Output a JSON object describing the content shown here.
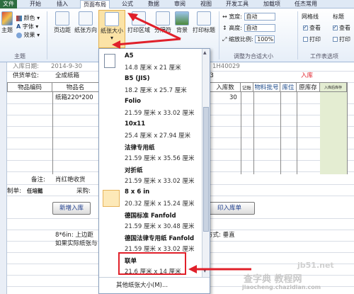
{
  "ribbon": {
    "tabs": [
      "文件",
      "开始",
      "插入",
      "页面布局",
      "公式",
      "数据",
      "审阅",
      "视图",
      "开发工具",
      "加载项",
      "任杰常用"
    ],
    "theme_group": {
      "themes_label": "主题",
      "colors_label": "颜色",
      "fonts_label": "字体",
      "effects_label": "效果",
      "group_label": "主题"
    },
    "page_setup": {
      "margins_label": "页边距",
      "orientation_label": "纸张方向",
      "size_label": "纸张大小",
      "print_area_label": "打印区域",
      "breaks_label": "分隔符",
      "background_label": "背景",
      "print_titles_label": "打印标题"
    },
    "scale_to_fit": {
      "width_label": "宽度:",
      "width_value": "自动",
      "height_label": "高度:",
      "height_value": "自动",
      "scale_label": "缩放比例:",
      "scale_value": "100%",
      "group_label": "调整为合适大小"
    },
    "sheet_options": {
      "gridlines_label": "网格线",
      "headings_label": "标题",
      "view_label": "查看",
      "print_label": "打印",
      "group_label": "工作表选项"
    }
  },
  "sheet": {
    "row1_left": "入库日期:",
    "row1_date": "2014-9-30",
    "row1_right": "1H40029",
    "supplier_label": "供货单位:",
    "supplier_value": "全成纸箱",
    "supplier_code": "03",
    "in_stock_red": "入库",
    "headers": [
      "物品编码",
      "物品名",
      "入库数",
      "记账",
      "物料批号",
      "库位",
      "原库存",
      "入库后库存"
    ],
    "item_name": "纸箱220*200",
    "quantity": "30",
    "remark_label": "备注:",
    "remark_value": "肖红艳收货",
    "maker_label": "制单:",
    "maker_value": "任培懿",
    "buyer_label": "采购:",
    "add_button": "新增入库",
    "print_button": "印入库单",
    "note_line1": "8*6in: 上边距",
    "note_line1_right": "方式: 垂直",
    "note_line2": "如果实际纸张与"
  },
  "paper_menu": {
    "items": [
      {
        "name": "A5",
        "size": "14.8 厘米 x 21 厘米"
      },
      {
        "name": "B5 (JIS)",
        "size": "18.2 厘米 x 25.7 厘米"
      },
      {
        "name": "Folio",
        "size": "21.59 厘米 x 33.02 厘米"
      },
      {
        "name": "10x11",
        "size": "25.4 厘米 x 27.94 厘米"
      },
      {
        "name": "法律专用纸",
        "size": "21.59 厘米 x 35.56 厘米"
      },
      {
        "name": "对折纸",
        "size": "21.59 厘米 x 33.02 厘米"
      },
      {
        "name": "8 x 6 in",
        "size": "20.32 厘米 x 15.24 厘米"
      },
      {
        "name": "德国标准 Fanfold",
        "size": "21.59 厘米 x 30.48 厘米"
      },
      {
        "name": "德国法律专用纸 Fanfold",
        "size": "21.59 厘米 x 33.02 厘米"
      },
      {
        "name": "联单",
        "size": "21.6 厘米 x 14 厘米"
      }
    ],
    "more_label": "其他纸张大小(M)..."
  },
  "watermark": {
    "line1": "查字典 教程网",
    "line2": "jiaocheng.chazidian.com",
    "line3": "jb51.net"
  },
  "colors": {
    "accent_red": "#e0202a",
    "ribbon_blue": "#dfe9f5",
    "file_tab": "#2d6d3f",
    "selected_item": "#fde9b8"
  }
}
